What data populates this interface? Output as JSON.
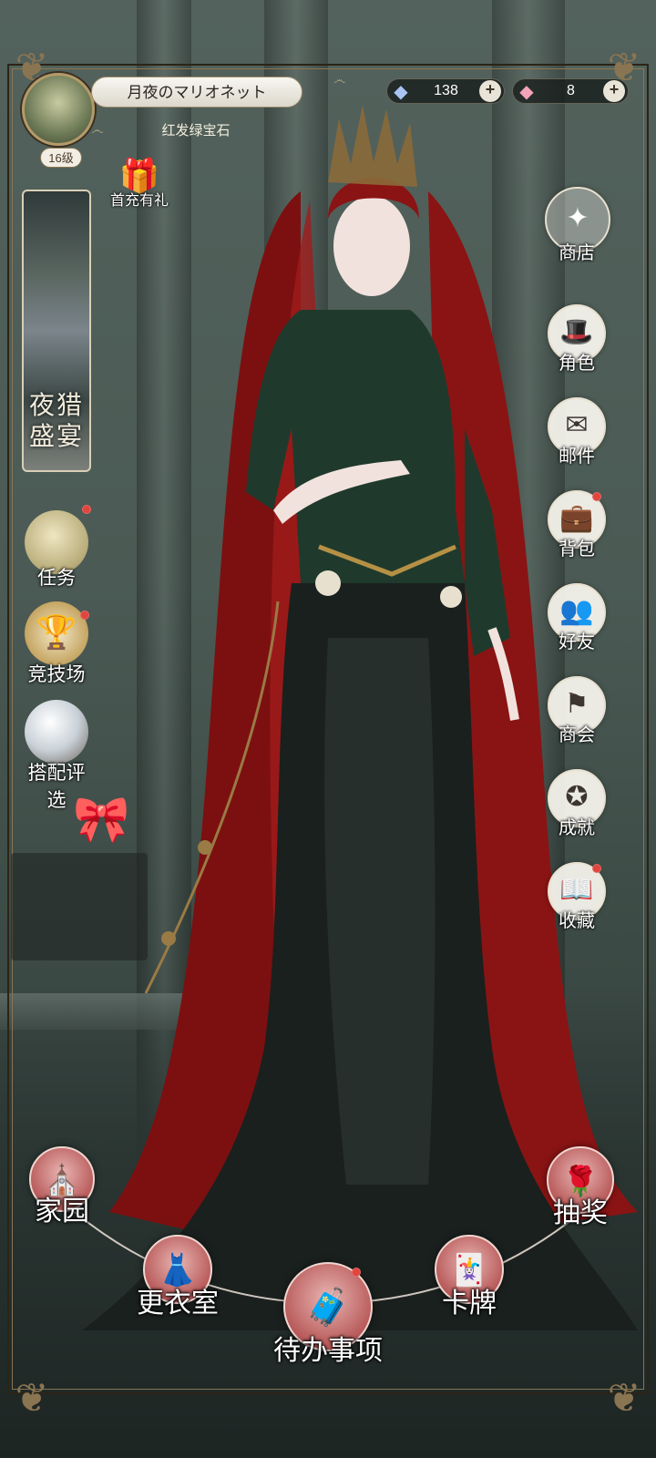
{
  "player": {
    "name": "月夜のマリオネット",
    "title": "红发绿宝石",
    "level": "16级"
  },
  "currencies": [
    {
      "name": "crystal",
      "value": "138"
    },
    {
      "name": "gem",
      "value": "8"
    }
  ],
  "gift": {
    "label": "首充有礼"
  },
  "event_banner": {
    "title_line1": "夜猎",
    "title_line2": "盛宴"
  },
  "left_menu": [
    {
      "label": "任务",
      "icon": "moon-icon",
      "badge": true
    },
    {
      "label": "竞技场",
      "icon": "trophy-icon",
      "badge": true
    },
    {
      "label": "搭配评选",
      "icon": "crystal-ball-icon",
      "badge": false
    }
  ],
  "right_menu": [
    {
      "label": "商店",
      "icon": "raven-icon",
      "badge": false
    },
    {
      "label": "角色",
      "icon": "top-hat-icon",
      "badge": false
    },
    {
      "label": "邮件",
      "icon": "envelope-icon",
      "badge": false
    },
    {
      "label": "背包",
      "icon": "briefcase-icon",
      "badge": true
    },
    {
      "label": "好友",
      "icon": "friends-icon",
      "badge": false
    },
    {
      "label": "商会",
      "icon": "banner-icon",
      "badge": false
    },
    {
      "label": "成就",
      "icon": "medal-icon",
      "badge": false
    },
    {
      "label": "收藏",
      "icon": "book-icon",
      "badge": true
    }
  ],
  "bottom_nav": [
    {
      "label": "家园",
      "icon": "cathedral-window-icon"
    },
    {
      "label": "更衣室",
      "icon": "dress-icon"
    },
    {
      "label": "待办事项",
      "icon": "suitcase-icon",
      "badge": true
    },
    {
      "label": "卡牌",
      "icon": "card-icon"
    },
    {
      "label": "抽奖",
      "icon": "rose-icon"
    }
  ],
  "colors": {
    "accent_gold": "#b49a6a",
    "badge_red": "#e2443e",
    "nav_pink": "#b85a5a",
    "hair_red": "#8e1414",
    "dress_green": "#1f3a2c"
  }
}
